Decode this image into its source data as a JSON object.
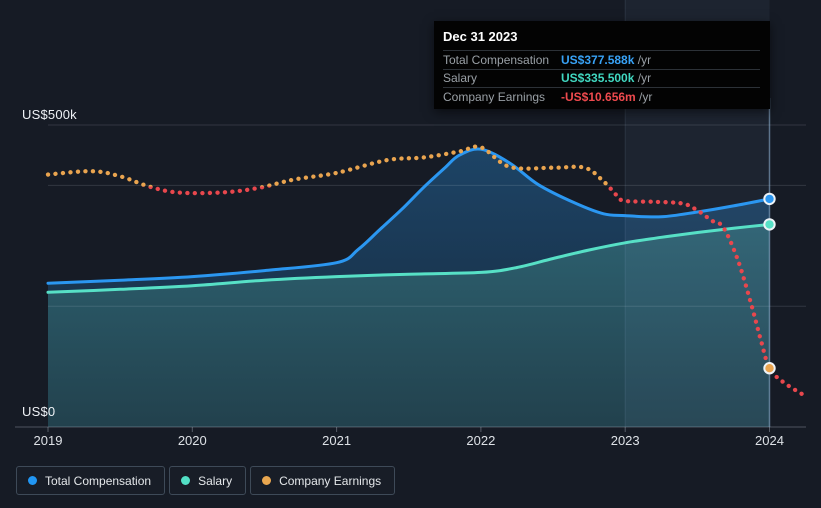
{
  "page": {
    "background_color": "#161b25"
  },
  "y_axis_labels": {
    "top": "US$500k",
    "bottom": "US$0"
  },
  "tooltip": {
    "title": "Dec 31 2023",
    "rows": [
      {
        "label": "Total Compensation",
        "value": "US$377.588k",
        "suffix": " /yr",
        "color": "#38a2f6"
      },
      {
        "label": "Salary",
        "value": "US$335.500k",
        "suffix": " /yr",
        "color": "#41d8c1"
      },
      {
        "label": "Company Earnings",
        "value": "-US$10.656m",
        "suffix": " /yr",
        "color": "#ef4a4e"
      }
    ]
  },
  "legend": {
    "items": [
      {
        "label": "Total Compensation",
        "color": "#2196f3"
      },
      {
        "label": "Salary",
        "color": "#52dfc5"
      },
      {
        "label": "Company Earnings",
        "color": "#e9a750"
      }
    ]
  },
  "chart_data": {
    "type": "line",
    "title": "Executive compensation over time",
    "x_axis": {
      "tick_labels": [
        "2019",
        "2020",
        "2021",
        "2022",
        "2023",
        "2024"
      ],
      "tick_years": [
        2019,
        2020,
        2021,
        2022,
        2023,
        2024
      ],
      "xlim": [
        2019,
        2024.25
      ]
    },
    "y_axis_compensation": {
      "unit": "US$k/yr",
      "ylim_k": [
        0,
        500
      ],
      "gridline_values_k": [
        500,
        400,
        200,
        0
      ]
    },
    "y_axis_earnings": {
      "unit": "US$m/yr",
      "zero_aligned_with_k": 400
    },
    "highlight_band": {
      "from_year": 2023,
      "to_year": 2024
    },
    "crosshair_year": 2024,
    "series": [
      {
        "name": "Total Compensation",
        "axis": "compensation",
        "style": "solid",
        "color": "#2b97f1",
        "area": "to-baseline",
        "area_top_color": "#1d4466",
        "area_bottom_color": "#16273a",
        "end_marker": true,
        "points": [
          [
            2019.0,
            238
          ],
          [
            2019.5,
            243
          ],
          [
            2020.0,
            249
          ],
          [
            2020.5,
            259
          ],
          [
            2021.0,
            272
          ],
          [
            2021.15,
            294
          ],
          [
            2021.3,
            327
          ],
          [
            2021.45,
            360
          ],
          [
            2021.6,
            396
          ],
          [
            2021.75,
            429
          ],
          [
            2021.85,
            450
          ],
          [
            2022.0,
            460
          ],
          [
            2022.2,
            437
          ],
          [
            2022.4,
            401
          ],
          [
            2022.65,
            371
          ],
          [
            2022.85,
            353
          ],
          [
            2023.0,
            350
          ],
          [
            2023.25,
            348
          ],
          [
            2023.5,
            356
          ],
          [
            2023.75,
            366
          ],
          [
            2024.0,
            377.588
          ]
        ]
      },
      {
        "name": "Salary",
        "axis": "compensation",
        "style": "solid",
        "color": "#57e0c6",
        "area": "to-baseline",
        "area_top_color": "#2d6170",
        "area_bottom_color": "#22414d",
        "end_marker": true,
        "points": [
          [
            2019.0,
            223
          ],
          [
            2019.5,
            228
          ],
          [
            2020.0,
            234
          ],
          [
            2020.5,
            243
          ],
          [
            2021.0,
            249
          ],
          [
            2021.5,
            253
          ],
          [
            2022.0,
            256
          ],
          [
            2022.25,
            264
          ],
          [
            2022.5,
            279
          ],
          [
            2022.75,
            293
          ],
          [
            2023.0,
            305
          ],
          [
            2023.25,
            314
          ],
          [
            2023.5,
            322
          ],
          [
            2023.75,
            329
          ],
          [
            2024.0,
            335.5
          ]
        ]
      },
      {
        "name": "Company Earnings",
        "axis": "earnings",
        "style": "dotted",
        "color": "#e9a44f",
        "color_negative": "#e8474d",
        "end_marker": true,
        "marker_year": 2024,
        "points": [
          [
            2019.0,
            0.7
          ],
          [
            2019.3,
            0.9
          ],
          [
            2019.5,
            0.6
          ],
          [
            2019.7,
            0.0
          ],
          [
            2019.9,
            -0.35
          ],
          [
            2020.2,
            -0.35
          ],
          [
            2020.45,
            -0.1
          ],
          [
            2020.7,
            0.4
          ],
          [
            2021.0,
            0.8
          ],
          [
            2021.35,
            1.55
          ],
          [
            2021.6,
            1.7
          ],
          [
            2021.85,
            2.05
          ],
          [
            2022.0,
            2.3
          ],
          [
            2022.2,
            1.15
          ],
          [
            2022.5,
            1.1
          ],
          [
            2022.72,
            1.1
          ],
          [
            2022.85,
            0.3
          ],
          [
            2022.95,
            -0.6
          ],
          [
            2023.0,
            -0.85
          ],
          [
            2023.2,
            -0.9
          ],
          [
            2023.4,
            -1.0
          ],
          [
            2023.5,
            -1.4
          ],
          [
            2023.6,
            -2.0
          ],
          [
            2023.68,
            -2.4
          ],
          [
            2023.78,
            -4.3
          ],
          [
            2023.87,
            -6.8
          ],
          [
            2023.94,
            -9.0
          ],
          [
            2024.0,
            -10.656
          ],
          [
            2024.1,
            -11.5
          ],
          [
            2024.25,
            -12.3
          ]
        ]
      }
    ]
  }
}
